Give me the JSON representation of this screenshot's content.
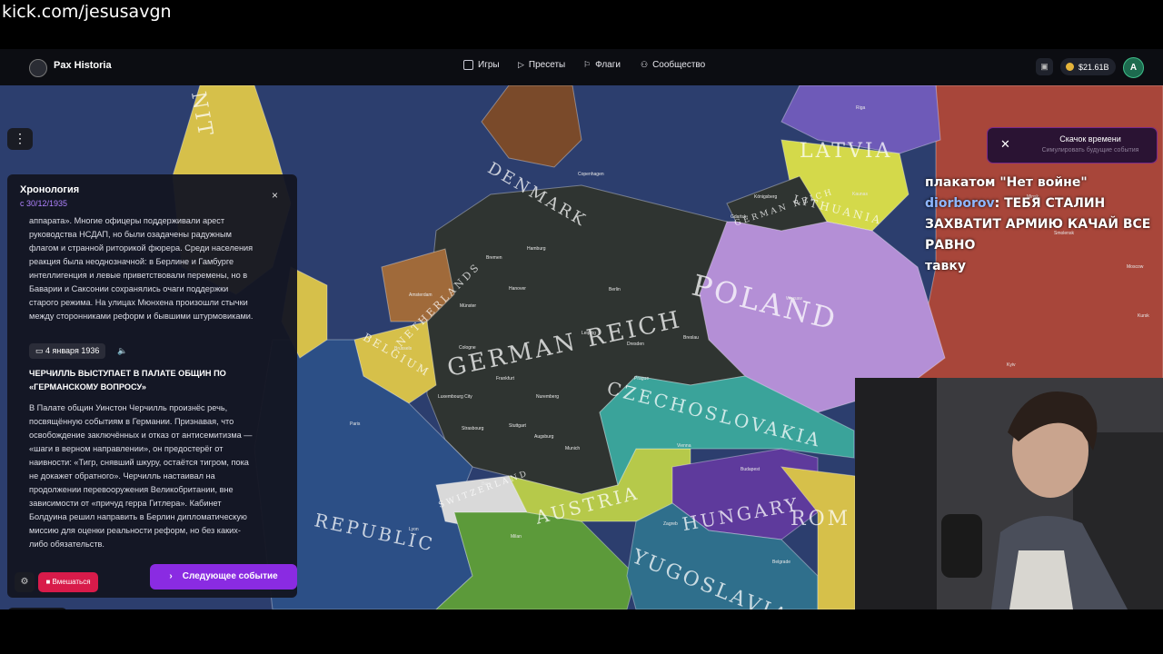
{
  "overlay": {
    "stream_url": "kick.com/jesusavgn"
  },
  "header": {
    "brand": "Pax Historia",
    "nav": [
      {
        "label": "Игры",
        "icon": "gamepad-icon"
      },
      {
        "label": "Пресеты",
        "icon": "play-icon"
      },
      {
        "label": "Флаги",
        "icon": "flag-icon"
      },
      {
        "label": "Сообщество",
        "icon": "people-icon"
      }
    ],
    "balance": "$21.61B",
    "avatar_letter": "A"
  },
  "map": {
    "countries": [
      "GERMAN REICH",
      "POLAND",
      "CZECHOSLOVAKIA",
      "AUSTRIA",
      "HUNGARY",
      "YUGOSLAVIA",
      "DENMARK",
      "LATVIA",
      "LITHUANIA",
      "NETHERLANDS",
      "BELGIUM",
      "REPUBLIC",
      "SWITZERLAND",
      "ROM",
      "GERMAN REICH",
      "NIT"
    ],
    "cities": [
      "Riga",
      "Kaunas",
      "Copenhagen",
      "Königsberg",
      "Gdańsk",
      "Hamburg",
      "Bremen",
      "Berlin",
      "Hanover",
      "Münster",
      "Amsterdam",
      "Brussels",
      "Cologne",
      "Frankfurt",
      "Luxembourg City",
      "Prague",
      "Nuremberg",
      "Stuttgart",
      "Munich",
      "Vienna",
      "Budapest",
      "Zagreb",
      "Belgrade",
      "Paris",
      "Lyon",
      "Milan",
      "Warsaw",
      "Kyiv",
      "Kursk",
      "Moscow",
      "Bern",
      "Strasbourg",
      "Augsburg",
      "Breslau",
      "Leipzig",
      "Dresden",
      "Minsk",
      "Smolensk"
    ]
  },
  "timeline": {
    "title": "Хронология",
    "since": "с 30/12/1935",
    "close": "×",
    "entry1": [
      "аппарата». Многие офицеры поддерживали арест",
      "руководства НСДАП, но были озадачены радужным",
      "флагом и странной риторикой фюрера. Среди населения",
      "реакция была неоднозначной: в Берлине и Гамбурге",
      "интеллигенция и левые приветствовали перемены, но в",
      "Баварии и Саксонии сохранялись очаги поддержки",
      "старого режима. На улицах Мюнхена произошли стычки",
      "между сторонниками реформ и бывшими штурмовиками."
    ],
    "date": "4 января 1936",
    "headline": "ЧЕРЧИЛЛЬ ВЫСТУПАЕТ В ПАЛАТЕ ОБЩИН ПО «ГЕРМАНСКОМУ ВОПРОСУ»",
    "entry2": [
      "В Палате общин Уинстон Черчилль произнёс речь,",
      "посвящённую событиям в Германии. Признавая, что",
      "освобождение заключённых и отказ от антисемитизма —",
      "«шаги в верном направлении», он предостерёг от",
      "наивности: «Тигр, снявший шкуру, остаётся тигром, пока",
      "не докажет обратного». Черчилль настаивал на",
      "продолжении перевооружения Великобритании, вне",
      "зависимости от «причуд герра Гитлера». Кабинет",
      "Болдуина решил направить в Берлин дипломатическую",
      "миссию для оценки реальности реформ, но без каких-",
      "либо обязательств."
    ],
    "intervene": "Вмешаться",
    "next_event": "Следующее событие"
  },
  "time_jump": {
    "title": "Скачок времени",
    "subtitle": "Симулировать будущие события"
  },
  "chat": [
    {
      "user": "",
      "text": "плакатом \"Нет войне\""
    },
    {
      "user": "diorborov",
      "text": ": ТЕБЯ СТАЛИН ЗАХВАТИТ АРМИЮ КАЧАЙ ВСЕ РАВНО"
    },
    {
      "user": "",
      "text": "тавку"
    }
  ],
  "colors": {
    "accent": "#8a2be2",
    "intervene": "#d81b4a",
    "since": "#b083ff",
    "germany": "#2f3431",
    "poland": "#b48fd6",
    "czechoslovakia": "#3aa39a",
    "hungary": "#5e3a9c",
    "austria": "#b6c94a",
    "yugoslavia": "#2f6f8c",
    "france": "#2c4f86",
    "belgium": "#d6c04a",
    "netherlands": "#a06a3a",
    "denmark": "#7a4a2a",
    "lithuania": "#d4d94a",
    "latvia": "#6e5ab8",
    "ussr": "#a8463a",
    "sea": "#2c3e6e"
  }
}
